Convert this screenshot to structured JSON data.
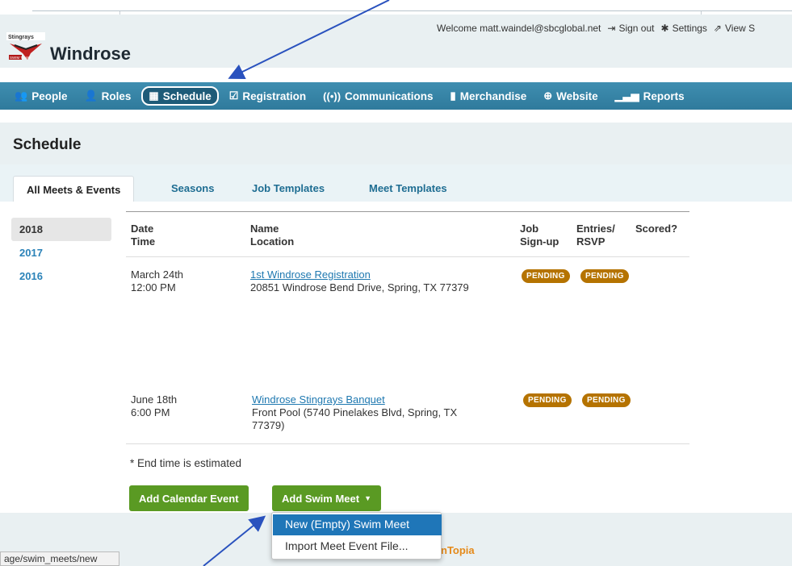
{
  "header": {
    "brand": "Windrose",
    "welcome": "Welcome matt.waindel@sbcglobal.net",
    "sign_out": "Sign out",
    "settings": "Settings",
    "view_site": "View S"
  },
  "nav": {
    "items": [
      {
        "label": "People",
        "icon": "people-icon"
      },
      {
        "label": "Roles",
        "icon": "roles-icon"
      },
      {
        "label": "Schedule",
        "icon": "calendar-icon",
        "active": true
      },
      {
        "label": "Registration",
        "icon": "clipboard-icon"
      },
      {
        "label": "Communications",
        "icon": "broadcast-icon"
      },
      {
        "label": "Merchandise",
        "icon": "bag-icon"
      },
      {
        "label": "Website",
        "icon": "globe-icon"
      },
      {
        "label": "Reports",
        "icon": "bar-chart-icon"
      }
    ]
  },
  "page": {
    "title": "Schedule"
  },
  "tabs": [
    "All Meets & Events",
    "Seasons",
    "Job Templates",
    "Meet Templates"
  ],
  "years": [
    "2018",
    "2017",
    "2016"
  ],
  "table": {
    "headers": {
      "date": "Date",
      "time": "Time",
      "name": "Name",
      "location": "Location",
      "job": "Job",
      "signup": "Sign-up",
      "entries": "Entries/",
      "rsvp": "RSVP",
      "scored": "Scored?"
    },
    "rows": [
      {
        "date": "March 24th",
        "time": "12:00 PM",
        "name": "1st Windrose Registration",
        "location": "20851 Windrose Bend Drive, Spring, TX 77379",
        "job_status": "PENDING",
        "entries_status": "PENDING"
      },
      {
        "date": "June 18th",
        "time": "6:00 PM",
        "name": "Windrose Stingrays Banquet",
        "location_line1": "Front Pool (5740 Pinelakes Blvd, Spring, TX",
        "location_line2": "77379)",
        "job_status": "PENDING",
        "entries_status": "PENDING"
      }
    ]
  },
  "note": "* End time is estimated",
  "buttons": {
    "add_calendar_event": "Add Calendar Event",
    "add_swim_meet": "Add Swim Meet"
  },
  "dropdown": {
    "items": [
      "New (Empty) Swim Meet",
      "Import Meet Event File..."
    ]
  },
  "footer": {
    "brand": "nTopia"
  },
  "statusbar": {
    "url": "age/swim_meets/new"
  },
  "colors": {
    "nav_bg": "#3a87a9",
    "badge": "#b57300",
    "button": "#5a9a23",
    "link": "#1e78b0",
    "dropdown_active": "#1f76b8",
    "annotation_arrow": "#2a52be"
  }
}
